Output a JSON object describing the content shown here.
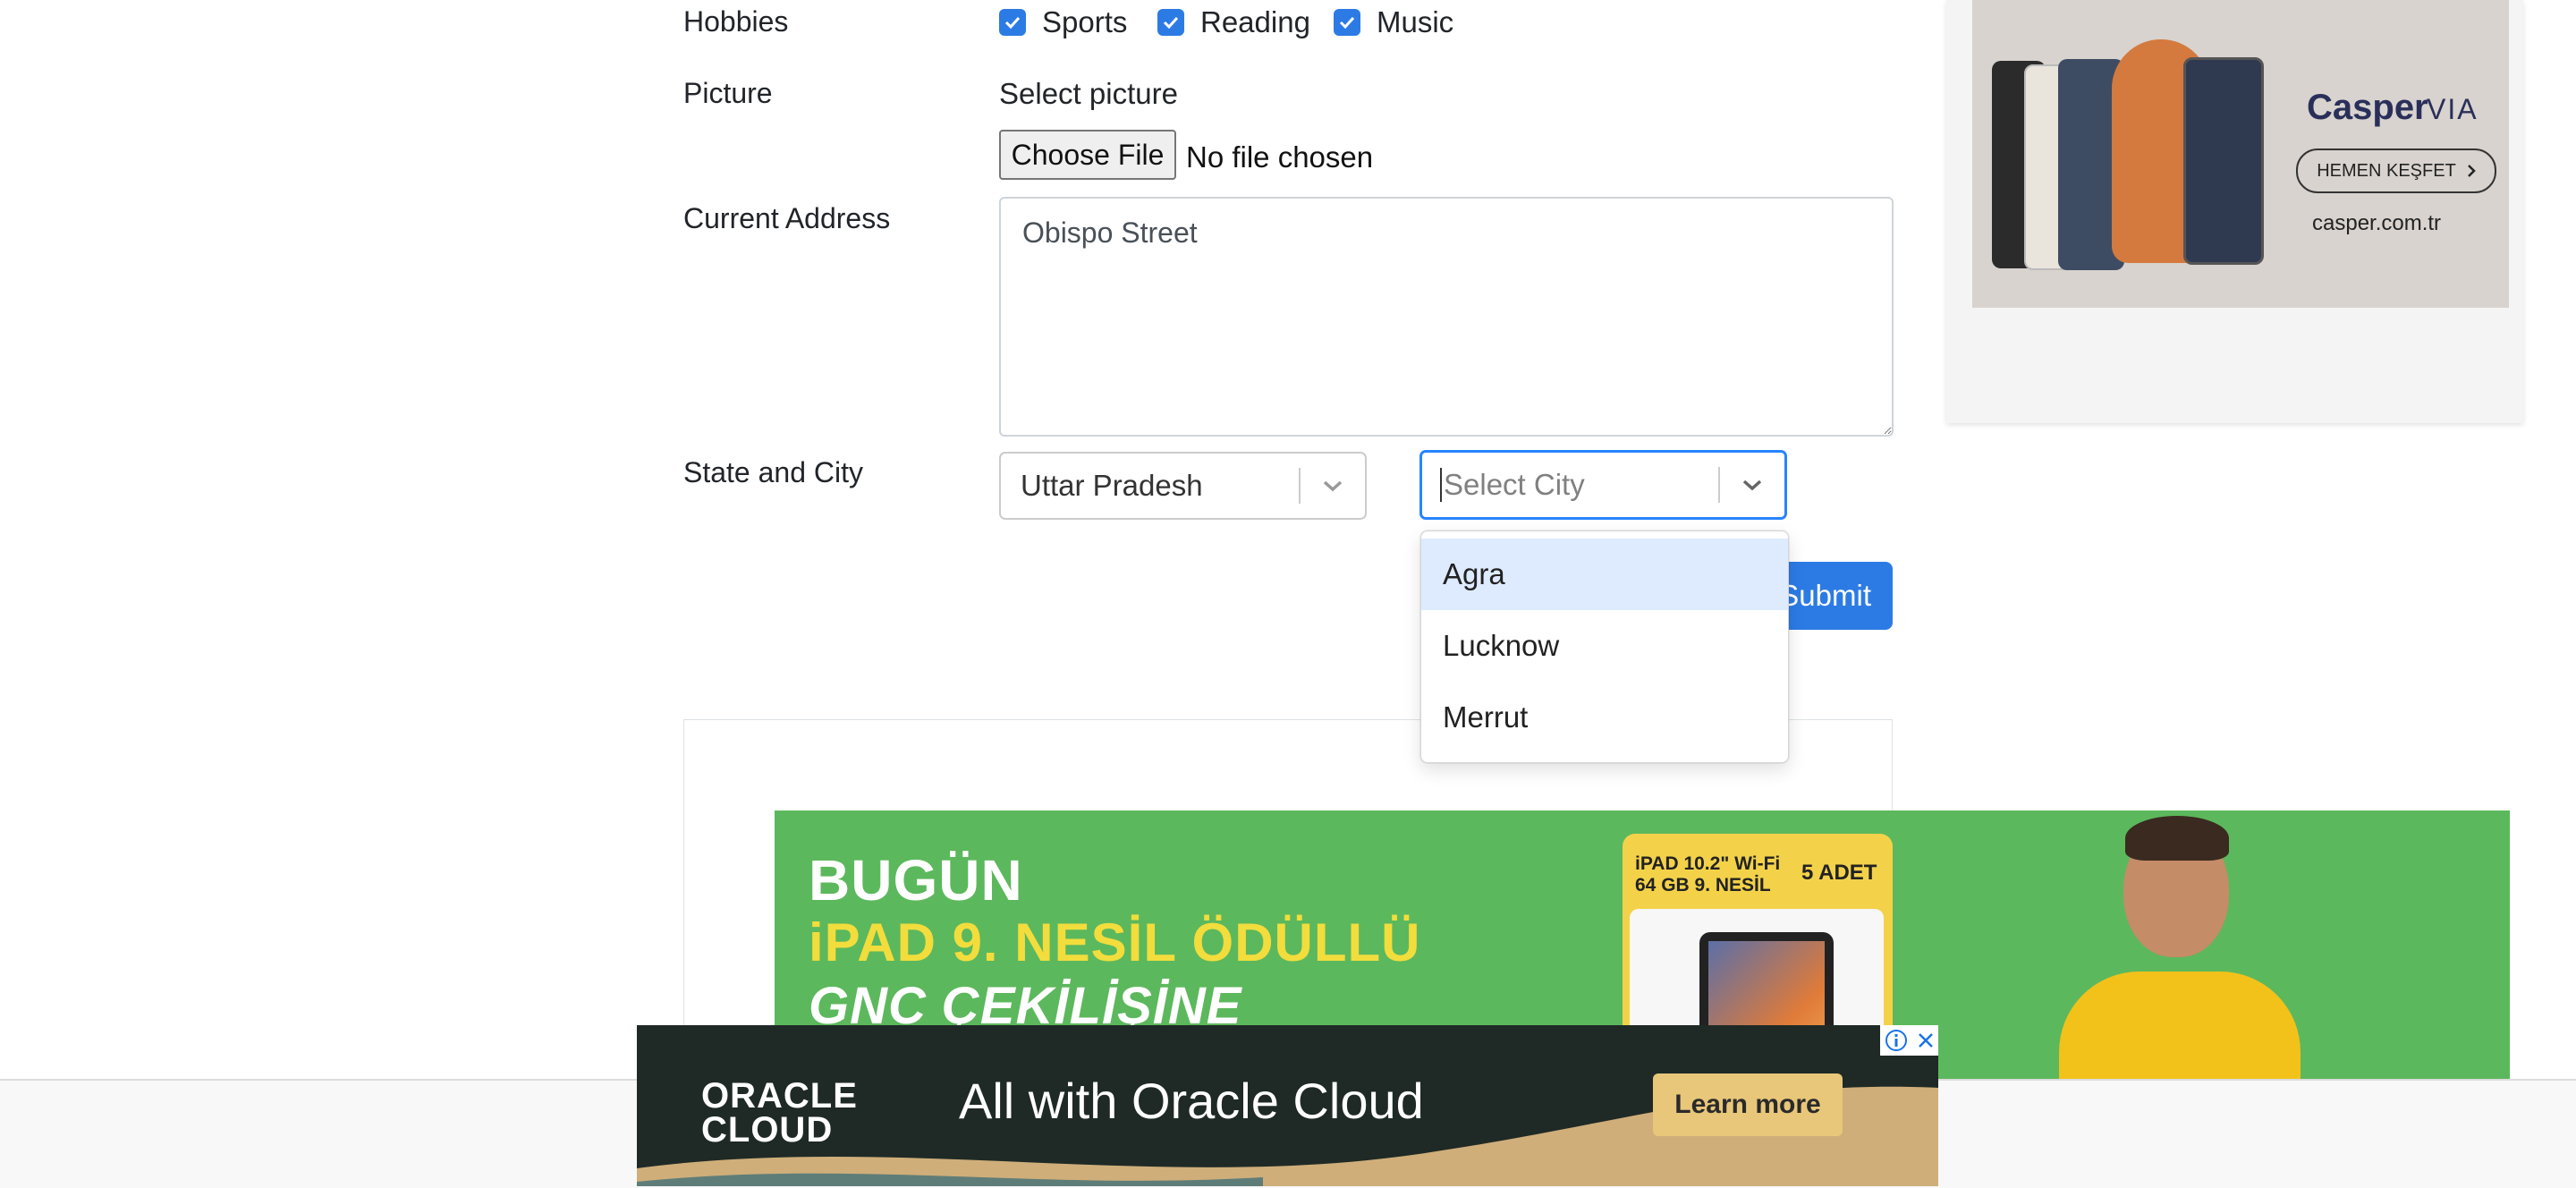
{
  "form": {
    "hobbies_label": "Hobbies",
    "hobbies": [
      {
        "label": "Sports",
        "checked": true
      },
      {
        "label": "Reading",
        "checked": true
      },
      {
        "label": "Music",
        "checked": true
      }
    ],
    "picture_label": "Picture",
    "picture_hint": "Select picture",
    "choose_file_label": "Choose File",
    "no_file_text": "No file chosen",
    "address_label": "Current Address",
    "address_value": "Obispo Street",
    "state_city_label": "State and City",
    "state_value": "Uttar Pradesh",
    "city_placeholder": "Select City",
    "city_options": [
      "Agra",
      "Lucknow",
      "Merrut"
    ],
    "submit_label": "Submit"
  },
  "ads": {
    "casper": {
      "brand": "Casper",
      "model": "VIA",
      "cta": "HEMEN KEŞFET",
      "url": "casper.com.tr"
    },
    "promo": {
      "line1": "BUGÜN",
      "line2": "iPAD 9. NESİL ÖDÜLLÜ",
      "line3": "GNC ÇEKİLİŞİNE",
      "badge_line1": "iPAD 10.2\" Wi-Fi",
      "badge_line2": "64 GB 9. NESİL",
      "badge_count": "5 ADET"
    },
    "oracle": {
      "logo_line1": "ORACLE",
      "logo_line2": "CLOUD",
      "tagline": "All with Oracle Cloud",
      "cta": "Learn more"
    }
  },
  "colors": {
    "accent": "#2c7be5",
    "focus": "#2684ff",
    "option_highlight": "#deebff",
    "promo_green": "#5cb85c",
    "promo_yellow": "#f2dd3d",
    "oracle_cta": "#e8c77a"
  }
}
